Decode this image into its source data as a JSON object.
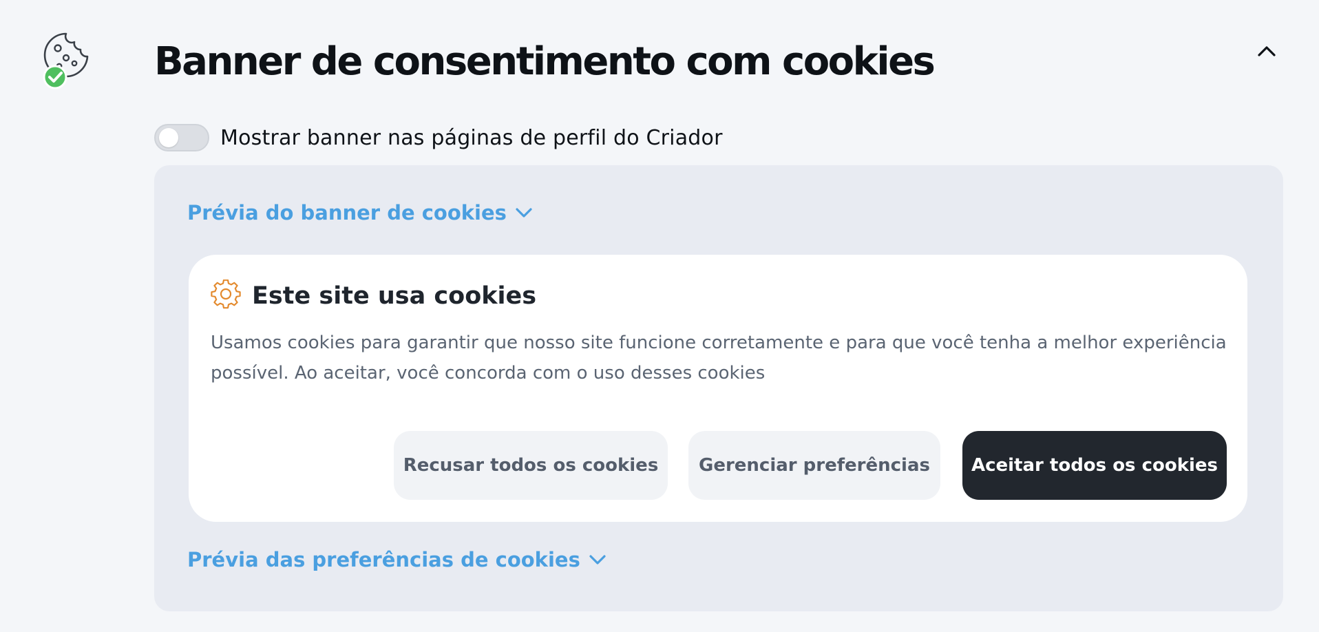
{
  "section": {
    "icon": "cookie-consent-icon",
    "title": "Banner de consentimento com cookies",
    "collapse_icon": "chevron-up-icon"
  },
  "toggle": {
    "label": "Mostrar banner nas páginas de perfil do Criador",
    "enabled": false
  },
  "preview": {
    "banner_link": "Prévia do banner de cookies",
    "preferences_link": "Prévia das preferências de cookies",
    "card": {
      "icon": "gear-icon",
      "title": "Este site usa cookies",
      "body": "Usamos cookies para garantir que nosso site funcione corretamente e para que você tenha a melhor experiência possível. Ao aceitar, você concorda com o uso desses cookies",
      "buttons": {
        "reject": "Recusar todos os cookies",
        "manage": "Gerenciar preferências",
        "accept": "Aceitar todos os cookies"
      }
    }
  },
  "colors": {
    "page_background": "#f4f6f9",
    "panel_background": "#e8ebf2",
    "link": "#4a9fe0",
    "primary_button": "#22272e",
    "secondary_button": "#f1f3f6",
    "check_badge": "#4fbf5f",
    "gear_icon": "#e38a2e"
  }
}
